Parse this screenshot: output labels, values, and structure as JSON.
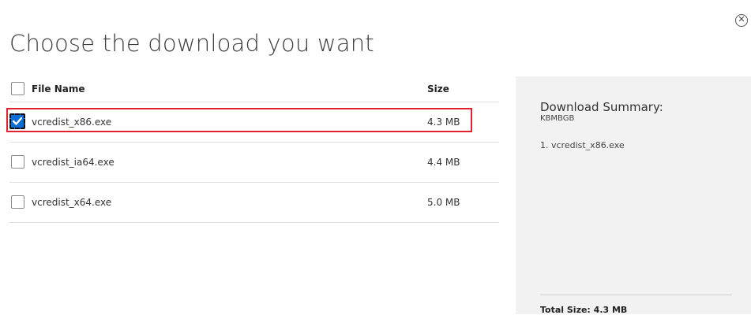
{
  "dialog": {
    "title": "Choose the download you want",
    "close_icon": "close-circle-icon"
  },
  "table": {
    "headers": {
      "file_name": "File Name",
      "size": "Size"
    },
    "rows": [
      {
        "name": "vcredist_x86.exe",
        "size": "4.3 MB",
        "checked": true
      },
      {
        "name": "vcredist_ia64.exe",
        "size": "4.4 MB",
        "checked": false
      },
      {
        "name": "vcredist_x64.exe",
        "size": "5.0 MB",
        "checked": false
      }
    ]
  },
  "summary": {
    "title": "Download Summary:",
    "units": "KBMBGB",
    "items": [
      "1. vcredist_x86.exe"
    ],
    "total": "Total Size: 4.3 MB"
  },
  "colors": {
    "checkbox_checked": "#0b6cd6",
    "highlight": "#e0212e",
    "panel_bg": "#f2f2f2"
  }
}
